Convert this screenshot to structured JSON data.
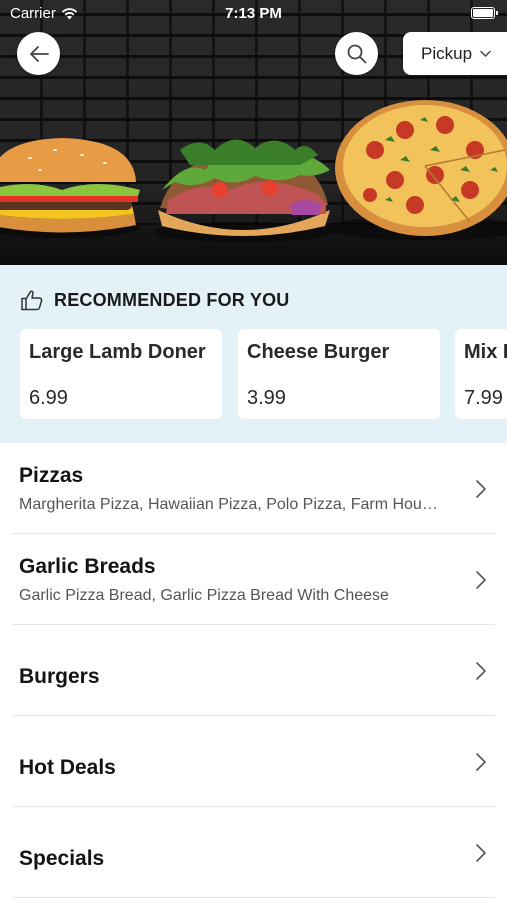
{
  "status_bar": {
    "carrier": "Carrier",
    "time": "7:13 PM"
  },
  "header": {
    "back_icon": "arrow-left-icon",
    "search_icon": "search-icon",
    "order_mode": "Pickup",
    "order_mode_icon": "chevron-down-icon"
  },
  "recommended": {
    "icon": "thumbs-up-icon",
    "title": "RECOMMENDED FOR YOU",
    "items": [
      {
        "name": "Large Lamb Doner",
        "price": "6.99"
      },
      {
        "name": "Cheese Burger",
        "price": "3.99"
      },
      {
        "name": "Mix Kebab",
        "price": "7.99"
      }
    ]
  },
  "categories": [
    {
      "title": "Pizzas",
      "subtitle": "Margherita Pizza, Hawaiian Pizza, Polo Pizza, Farm House Pizza"
    },
    {
      "title": "Garlic Breads",
      "subtitle": "Garlic Pizza Bread, Garlic Pizza Bread With Cheese"
    },
    {
      "title": "Burgers",
      "subtitle": ""
    },
    {
      "title": "Hot Deals",
      "subtitle": ""
    },
    {
      "title": "Specials",
      "subtitle": ""
    }
  ],
  "colors": {
    "accent_bg": "#e4f1f7",
    "card_bg": "#ffffff",
    "text": "#141414",
    "muted": "#555555"
  }
}
